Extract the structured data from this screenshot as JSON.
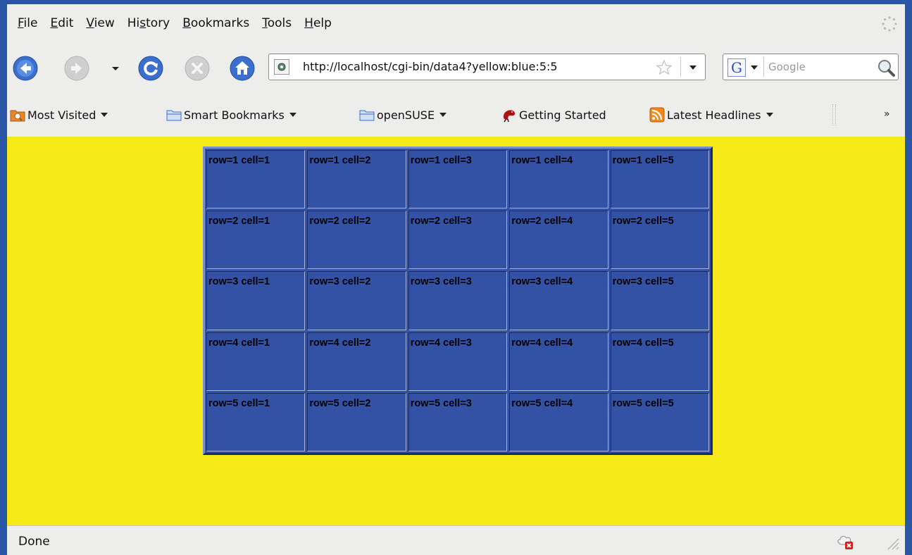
{
  "menu": [
    {
      "pre": "",
      "acc": "F",
      "post": "ile"
    },
    {
      "pre": "",
      "acc": "E",
      "post": "dit"
    },
    {
      "pre": "",
      "acc": "V",
      "post": "iew"
    },
    {
      "pre": "Hi",
      "acc": "s",
      "post": "tory"
    },
    {
      "pre": "",
      "acc": "B",
      "post": "ookmarks"
    },
    {
      "pre": "",
      "acc": "T",
      "post": "ools"
    },
    {
      "pre": "",
      "acc": "H",
      "post": "elp"
    }
  ],
  "navigation": {
    "url": "http://localhost/cgi-bin/data4?yellow:blue:5:5",
    "search_placeholder": "Google",
    "search_engine_glyph": "G"
  },
  "bookmarks": [
    {
      "label": "Most Visited",
      "icon": "most-visited-icon",
      "dropdown": true
    },
    {
      "label": "Smart Bookmarks",
      "icon": "folder-icon",
      "dropdown": true
    },
    {
      "label": "openSUSE",
      "icon": "folder-icon",
      "dropdown": true
    },
    {
      "label": "Getting Started",
      "icon": "gecko-icon",
      "dropdown": false
    },
    {
      "label": "Latest Headlines",
      "icon": "rss-icon",
      "dropdown": true
    }
  ],
  "bookmarks_more": "»",
  "table": {
    "rows": [
      [
        "row=1 cell=1",
        "row=1 cell=2",
        "row=1 cell=3",
        "row=1 cell=4",
        "row=1 cell=5"
      ],
      [
        "row=2 cell=1",
        "row=2 cell=2",
        "row=2 cell=3",
        "row=2 cell=4",
        "row=2 cell=5"
      ],
      [
        "row=3 cell=1",
        "row=3 cell=2",
        "row=3 cell=3",
        "row=3 cell=4",
        "row=3 cell=5"
      ],
      [
        "row=4 cell=1",
        "row=4 cell=2",
        "row=4 cell=3",
        "row=4 cell=4",
        "row=4 cell=5"
      ],
      [
        "row=5 cell=1",
        "row=5 cell=2",
        "row=5 cell=3",
        "row=5 cell=4",
        "row=5 cell=5"
      ]
    ]
  },
  "status": {
    "text": "Done"
  },
  "colors": {
    "page_background": "#f7e917",
    "table_background": "#3452a5",
    "window_frame": "#2a56a6",
    "chrome": "#ededec"
  }
}
